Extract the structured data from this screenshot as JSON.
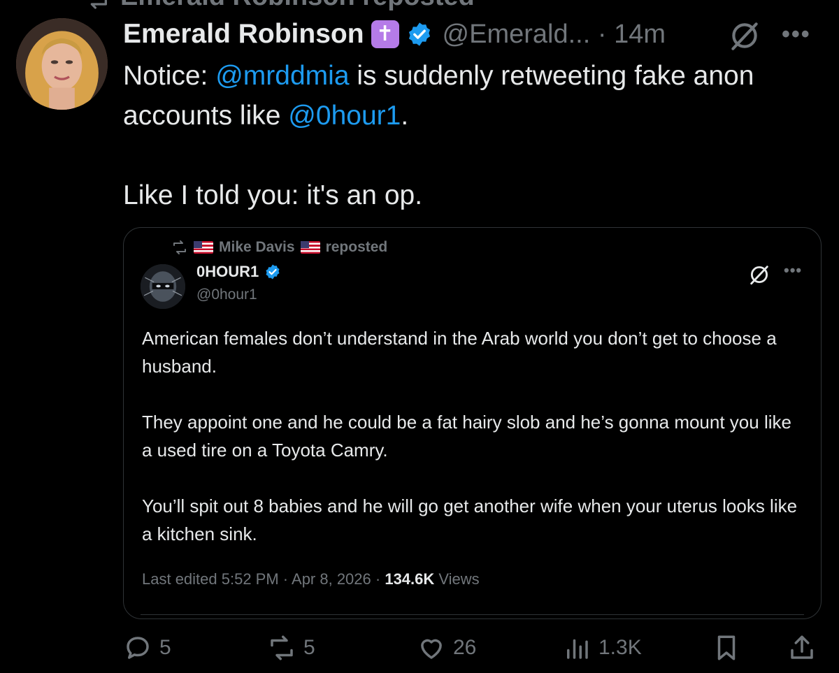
{
  "repost_header": {
    "text": "Emerald Robinson reposted"
  },
  "tweet": {
    "author_name": "Emerald Robinson",
    "badge_glyph": "✝",
    "handle": "@Emerald...",
    "separator": "·",
    "time": "14m",
    "text": {
      "line1_pre": "Notice: ",
      "mention1": "@mrddmia",
      "line1_post": " is suddenly retweeting fake anon accounts like ",
      "mention2": "@0hour1",
      "line1_end": ".",
      "line2": "Like I told you: it's an op."
    }
  },
  "quote": {
    "reposted_by": "Mike Davis",
    "reposted_label": "reposted",
    "author_name": "0HOUR1",
    "handle": "@0hour1",
    "paragraphs": [
      "American females don’t understand in the Arab world you don’t get to choose a husband.",
      "They appoint one and he could be a fat hairy slob and he’s gonna mount you like a used tire on a Toyota Camry.",
      "You’ll spit out 8 babies and he will go get another wife when your uterus looks like a kitchen sink."
    ],
    "meta": {
      "edited": "Last edited 5:52 PM · Apr 8, 2026 · ",
      "views_count": "134.6K",
      "views_label": " Views"
    }
  },
  "actions": {
    "replies": "5",
    "reposts": "5",
    "likes": "26",
    "views": "1.3K"
  },
  "colors": {
    "background": "#000000",
    "text": "#e7e9ea",
    "muted": "#71767b",
    "link": "#1d9bf0",
    "verified": "#1d9bf0",
    "badge": "#b57be8",
    "border": "#2f3336"
  }
}
